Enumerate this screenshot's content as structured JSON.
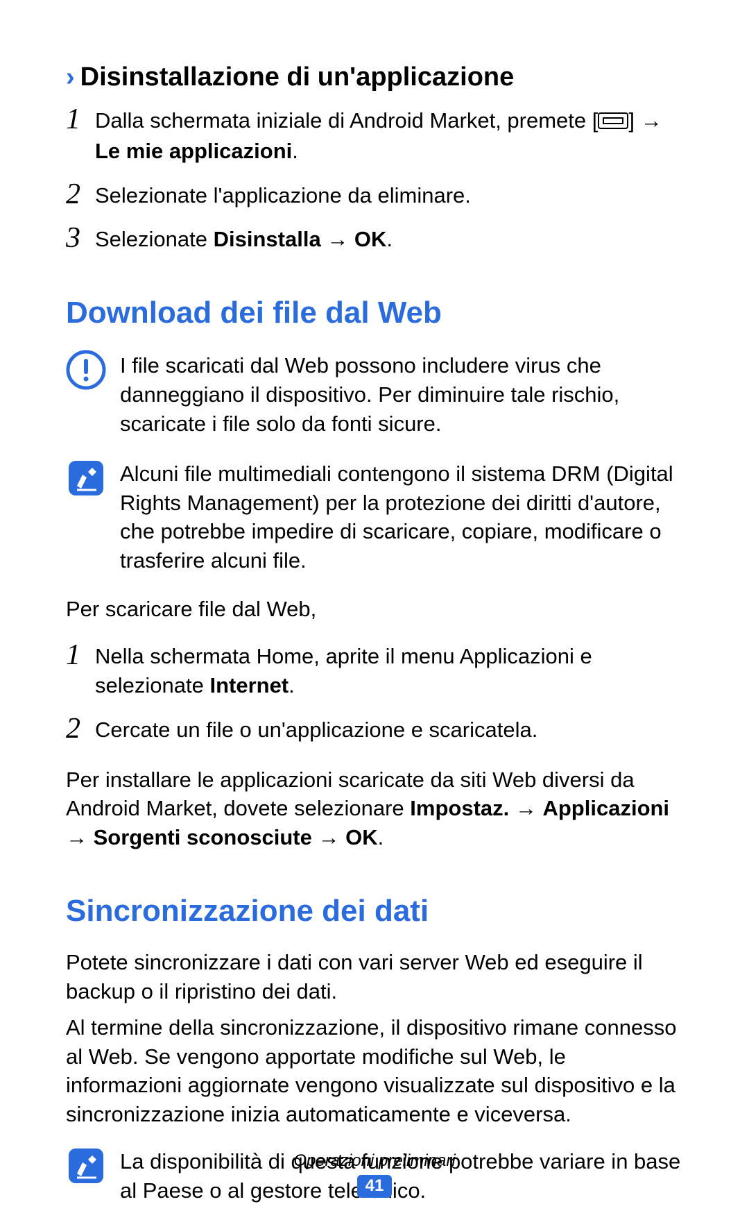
{
  "subheading": {
    "title": "Disinstallazione di un'applicazione",
    "steps": [
      {
        "num": "1",
        "pre": "Dalla schermata iniziale di Android Market, premete [",
        "post": "] →",
        "bold": "Le mie applicazioni",
        "suffix": "."
      },
      {
        "num": "2",
        "text": "Selezionate l'applicazione da eliminare."
      },
      {
        "num": "3",
        "pre": "Selezionate ",
        "bold1": "Disinstalla",
        "mid": " → ",
        "bold2": "OK",
        "suffix": "."
      }
    ]
  },
  "section1": {
    "title": "Download dei file dal Web",
    "warning": "I file scaricati dal Web possono includere virus che danneggiano il dispositivo. Per diminuire tale rischio, scaricate i file solo da fonti sicure.",
    "note": "Alcuni file multimediali contengono il sistema DRM (Digital Rights Management) per la protezione dei diritti d'autore, che potrebbe impedire di scaricare, copiare, modificare o trasferire alcuni file.",
    "lead": "Per scaricare file dal Web,",
    "steps": [
      {
        "num": "1",
        "pre": "Nella schermata Home, aprite il menu Applicazioni e selezionate ",
        "bold": "Internet",
        "suffix": "."
      },
      {
        "num": "2",
        "text": "Cercate un file o un'applicazione e scaricatela."
      }
    ],
    "p2_pre": "Per installare le applicazioni scaricate da siti Web diversi da Android Market, dovete selezionare ",
    "p2_b1": "Impostaz.",
    "p2_m1": " → ",
    "p2_b2": "Applicazioni",
    "p2_m2": " → ",
    "p2_b3": "Sorgenti sconosciute",
    "p2_m3": " → ",
    "p2_b4": "OK",
    "p2_suffix": "."
  },
  "section2": {
    "title": "Sincronizzazione dei dati",
    "p1": "Potete sincronizzare i dati con vari server Web ed eseguire il backup o il ripristino dei dati.",
    "p2": "Al termine della sincronizzazione, il dispositivo rimane connesso al Web. Se vengono apportate modifiche sul Web, le informazioni aggiornate vengono visualizzate sul dispositivo e la sincronizzazione inizia automaticamente e viceversa.",
    "note": "La disponibilità di questa funzione potrebbe variare in base al Paese o al gestore telefonico."
  },
  "footer": {
    "label": "Operazioni preliminari",
    "page": "41"
  }
}
